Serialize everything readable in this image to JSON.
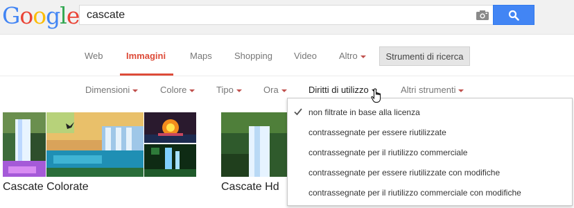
{
  "logo": {
    "letters": [
      "G",
      "o",
      "o",
      "g",
      "l",
      "e"
    ],
    "colors": [
      "#4285f4",
      "#ea4335",
      "#fbbc05",
      "#4285f4",
      "#34a853",
      "#ea4335"
    ]
  },
  "search": {
    "query": "cascate",
    "camera_icon": "camera-icon",
    "button_icon": "search-icon"
  },
  "tabs": [
    {
      "label": "Web"
    },
    {
      "label": "Immagini"
    },
    {
      "label": "Maps"
    },
    {
      "label": "Shopping"
    },
    {
      "label": "Video"
    },
    {
      "label": "Altro"
    }
  ],
  "tools_button": "Strumenti di ricerca",
  "filters": [
    {
      "label": "Dimensioni"
    },
    {
      "label": "Colore"
    },
    {
      "label": "Tipo"
    },
    {
      "label": "Ora"
    },
    {
      "label": "Diritti di utilizzo"
    },
    {
      "label": "Altri strumenti"
    }
  ],
  "results": [
    {
      "title": "Cascate Colorate"
    },
    {
      "title": "Cascate Hd"
    }
  ],
  "dropdown": {
    "items": [
      {
        "label": "non filtrate in base alla licenza",
        "checked": true
      },
      {
        "label": "contrassegnate per essere riutilizzate",
        "checked": false
      },
      {
        "label": "contrassegnate per il riutilizzo commerciale",
        "checked": false
      },
      {
        "label": "contrassegnate per essere riutilizzate con modifiche",
        "checked": false
      },
      {
        "label": "contrassegnate per il riutilizzo commerciale con modifiche",
        "checked": false
      }
    ]
  },
  "colors": {
    "accent_red": "#dd4b39",
    "search_blue": "#4285f4"
  }
}
